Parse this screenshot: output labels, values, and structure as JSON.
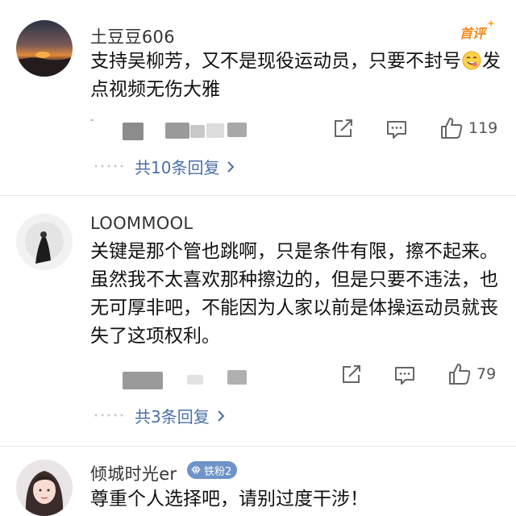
{
  "comments": [
    {
      "username": "土豆豆606",
      "badge": "首评",
      "content_before_emoji": "支持吴柳芳，又不是现役运动员，只要不封号",
      "content_after_emoji": "发点视频无伤大雅",
      "like_count": "119",
      "replies_label": "共10条回复"
    },
    {
      "username": "LOOMMOOL",
      "content": "关键是那个管也跳啊，只是条件有限，擦不起来。虽然我不太喜欢那种擦边的，但是只要不违法，也无可厚非吧，不能因为人家以前是体操运动员就丧失了这项权利。",
      "like_count": "79",
      "replies_label": "共3条回复"
    },
    {
      "username": "倾城时光er",
      "fan_badge": "铁粉2",
      "content": "尊重个人选择吧，请别过度干涉！"
    }
  ],
  "icons": {
    "repost": "share-square-icon",
    "comment": "comment-bubble-icon",
    "like": "thumbs-up-icon",
    "chevron": "chevron-right-icon",
    "diamond": "diamond-icon"
  },
  "colors": {
    "badge_orange": "#f08a1c",
    "link_blue": "#4a6fa5",
    "fan_blue": "#6e93c8"
  }
}
